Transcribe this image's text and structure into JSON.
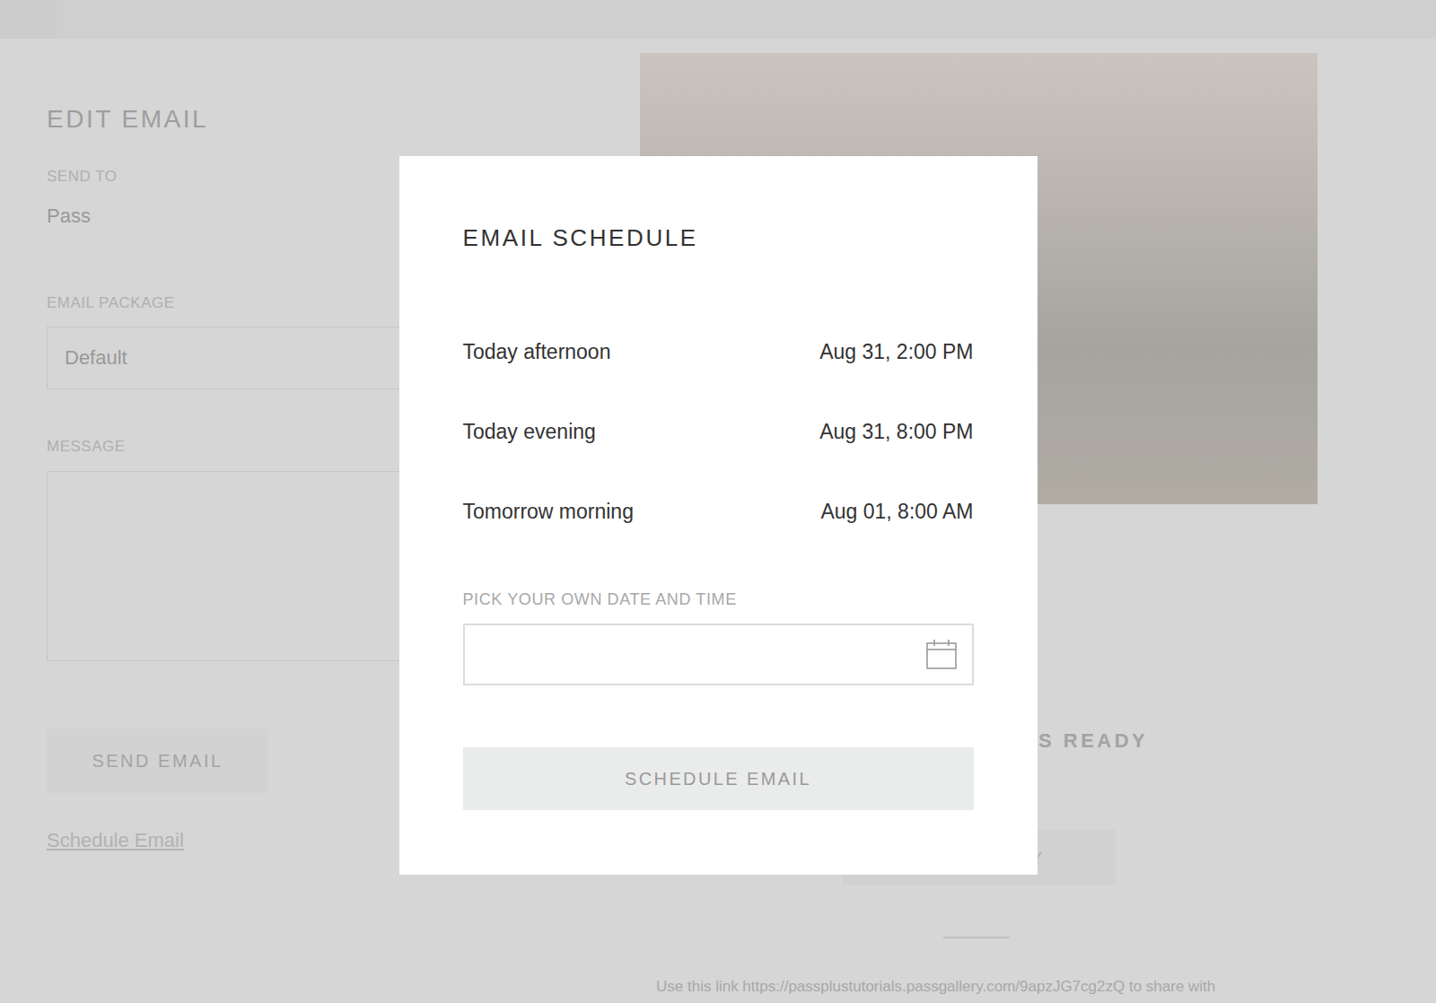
{
  "page": {
    "heading": "EDIT EMAIL",
    "send_to": {
      "label": "SEND TO",
      "value": "Pass"
    },
    "email_package": {
      "label": "EMAIL PACKAGE",
      "value": "Default"
    },
    "message": {
      "label": "MESSAGE",
      "value": ""
    },
    "send_button": "SEND EMAIL",
    "schedule_link": "Schedule Email",
    "ready_heading": "S READY",
    "ready_button": "Y",
    "share_text": "Use this link https://passplustutorials.passgallery.com/9apzJG7cg2zQ to share with"
  },
  "modal": {
    "title": "EMAIL SCHEDULE",
    "options": [
      {
        "label": "Today afternoon",
        "time": "Aug 31, 2:00 PM",
        "selected": false
      },
      {
        "label": "Today evening",
        "time": "Aug 31, 8:00 PM",
        "selected": false
      },
      {
        "label": "Tomorrow morning",
        "time": "Aug 01, 8:00 AM",
        "selected": false
      }
    ],
    "custom": {
      "label": "PICK YOUR OWN DATE AND TIME",
      "value": ""
    },
    "button": {
      "label": "SCHEDULE EMAIL",
      "disabled": true
    }
  }
}
